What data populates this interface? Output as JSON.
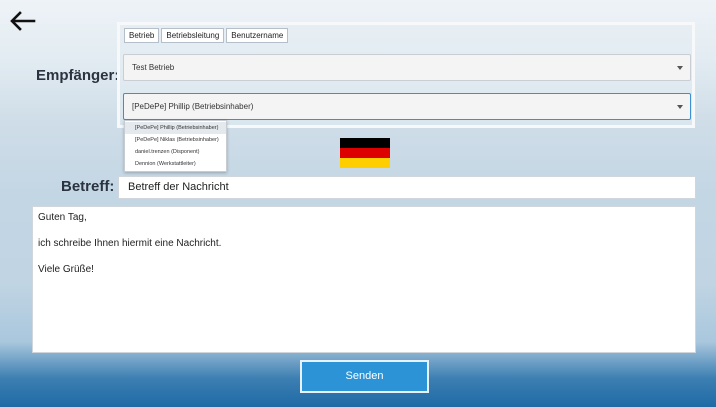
{
  "back": {
    "icon": "back-arrow-icon"
  },
  "recipient": {
    "label": "Empfänger:",
    "tabs": [
      "Betrieb",
      "Betriebsleitung",
      "Benutzername"
    ],
    "betrieb_value": "Test Betrieb",
    "person_value": "[PeDePe] Phillip (Betriebsinhaber)",
    "dropdown_options": [
      "[PeDePe] Phillip (Betriebsinhaber)",
      "[PeDePe] Niklas (Betriebsinhaber)",
      "daniel.trenzen (Disponent)",
      "Dennion (Werkstattleiter)"
    ]
  },
  "flag": {
    "icon": "german-flag-icon",
    "colors": [
      "#000000",
      "#dd0000",
      "#ffce00"
    ]
  },
  "subject": {
    "label": "Betreff:",
    "value": "Betreff der Nachricht"
  },
  "message": {
    "lines": [
      "Guten Tag,",
      "ich schreibe Ihnen hiermit eine Nachricht.",
      "Viele Grüße!"
    ]
  },
  "send": {
    "label": "Senden"
  },
  "colors": {
    "accent": "#2b93d6",
    "focus_border": "#3a8fd6"
  }
}
